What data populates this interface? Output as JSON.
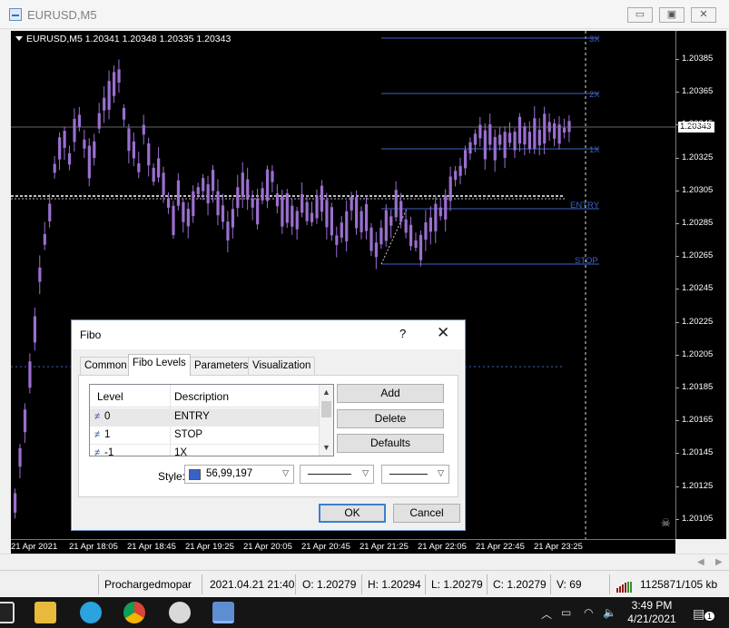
{
  "window": {
    "title": "EURUSD,M5",
    "buttons": {
      "minimize": "▭",
      "maximize": "▣",
      "close": "✕"
    }
  },
  "chart": {
    "header": "EURUSD,M5  1.20341 1.20348 1.20335 1.20343",
    "current_price": "1.20343",
    "price_labels": [
      "1.20385",
      "1.20365",
      "1.20345",
      "1.20325",
      "1.20305",
      "1.20285",
      "1.20265",
      "1.20245",
      "1.20225",
      "1.20205",
      "1.20185",
      "1.20165",
      "1.20145",
      "1.20125",
      "1.20105"
    ],
    "time_labels": [
      "21 Apr 2021",
      "21 Apr 18:05",
      "21 Apr 18:45",
      "21 Apr 19:25",
      "21 Apr 20:05",
      "21 Apr 20:45",
      "21 Apr 21:25",
      "21 Apr 22:05",
      "21 Apr 22:45",
      "21 Apr 23:25"
    ],
    "fibo_levels": [
      "3X",
      "2X",
      "1X",
      "ENTRY",
      "STOP"
    ],
    "colors": {
      "candle": "#9b6fd0",
      "fibo": "#3f63c5",
      "background": "#000000",
      "dashed_line": "#ffffff"
    }
  },
  "status": {
    "profile": "Prochargedmopar",
    "datetime": "2021.04.21 21:40",
    "open": "O: 1.20279",
    "high": "H: 1.20294",
    "low": "L: 1.20279",
    "close": "C: 1.20279",
    "volume": "V: 69",
    "traffic": "1125871/105 kb"
  },
  "taskbar": {
    "time": "3:49 PM",
    "date": "4/21/2021",
    "notifications": "1"
  },
  "dialog": {
    "title": "Fibo",
    "help": "?",
    "close": "✕",
    "tabs": [
      "Common",
      "Fibo Levels",
      "Parameters",
      "Visualization"
    ],
    "active_tab": "Fibo Levels",
    "grid": {
      "headers": {
        "level": "Level",
        "description": "Description"
      },
      "rows": [
        {
          "level": "0",
          "description": "ENTRY"
        },
        {
          "level": "1",
          "description": "STOP"
        },
        {
          "level": "-1",
          "description": "1X"
        }
      ]
    },
    "buttons": {
      "add": "Add",
      "delete": "Delete",
      "defaults": "Defaults",
      "ok": "OK",
      "cancel": "Cancel"
    },
    "style": {
      "label": "Style:",
      "color_value": "56,99,197",
      "color_hex": "#3863c5"
    }
  }
}
